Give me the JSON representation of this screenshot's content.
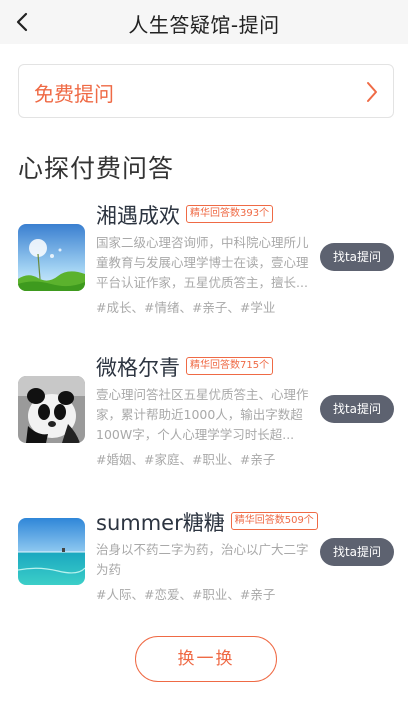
{
  "header": {
    "title": "人生答疑馆-提问"
  },
  "free_question": {
    "label": "免费提问"
  },
  "section": {
    "title": "心探付费问答"
  },
  "answerers": [
    {
      "name": "湘遇成欢",
      "badge": "精华回答数393个",
      "desc": "国家二级心理咨询师，中科院心理所儿童教育与发展心理学博士在读，壹心理平台认证作家，五星优质答主，擅长...",
      "tags": "#成长、#情绪、#亲子、#学业",
      "button": "找ta提问"
    },
    {
      "name": "微格尔青",
      "badge": "精华回答数715个",
      "desc": "壹心理问答社区五星优质答主、心理作家，累计帮助近1000人，输出字数超100W字，个人心理学学习时长超...",
      "tags": "#婚姻、#家庭、#职业、#亲子",
      "button": "找ta提问"
    },
    {
      "name": "summer糖糖",
      "badge": "精华回答数509个",
      "desc": "治身以不药二字为药，治心以广大二字为药",
      "tags": "#人际、#恋爱、#职业、#亲子",
      "button": "找ta提问"
    }
  ],
  "refresh": {
    "label": "换一换"
  },
  "colors": {
    "accent": "#ef6a45",
    "button_bg": "#5d6270",
    "header_bg": "#f6f6f6"
  }
}
